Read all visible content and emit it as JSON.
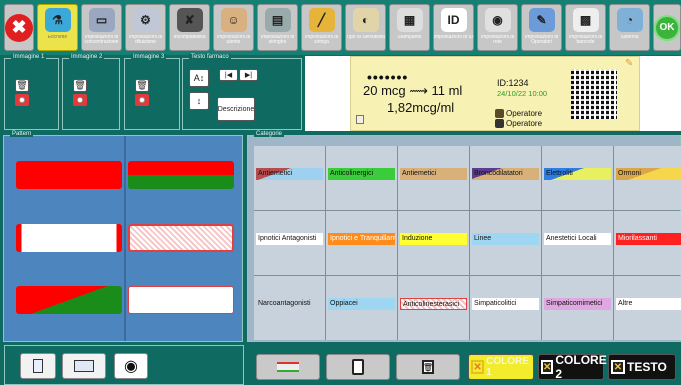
{
  "toolbar": {
    "close_label": "✖",
    "ok_label": "OK",
    "buttons": [
      {
        "id": "b1",
        "label": "Etichette",
        "glyph": "⚗",
        "color": "#3aa8d8",
        "active": true
      },
      {
        "id": "b2",
        "label": "Impostazioni di concentrazione",
        "glyph": "▭",
        "color": "#9aa7c0",
        "active": false
      },
      {
        "id": "b3",
        "label": "Impostazioni di diluizione",
        "glyph": "⚙",
        "color": "#c0c8d8",
        "active": false
      },
      {
        "id": "b4",
        "label": "Incompatibilità",
        "glyph": "✘",
        "color": "#555",
        "active": false
      },
      {
        "id": "b5",
        "label": "Impostazioni di utente",
        "glyph": "☺",
        "color": "#d9b07f",
        "active": false
      },
      {
        "id": "b6",
        "label": "Impostazioni di siringhe",
        "glyph": "▤",
        "color": "#9aa",
        "active": false
      },
      {
        "id": "b7",
        "label": "Impostazioni di siringa",
        "glyph": "╱",
        "color": "#e7b43a",
        "active": false
      },
      {
        "id": "b8",
        "label": "Tipo di Sensibilità",
        "glyph": "◐",
        "color": "#e0d4a8",
        "active": false
      },
      {
        "id": "b9",
        "label": "Stampante",
        "glyph": "▦",
        "color": "#ddd",
        "active": false
      },
      {
        "id": "b10",
        "label": "Impostazioni di ID",
        "glyph": "ID",
        "color": "#fff",
        "active": false
      },
      {
        "id": "b11",
        "label": "Impostazioni di rete",
        "glyph": "◉",
        "color": "#e0e0e0",
        "active": false
      },
      {
        "id": "b12",
        "label": "Impostazioni di Operatori",
        "glyph": "✎",
        "color": "#6b9bd8",
        "active": false
      },
      {
        "id": "b13",
        "label": "Impostazioni di barcode",
        "glyph": "▩",
        "color": "#eee",
        "active": false
      },
      {
        "id": "b14",
        "label": "Sistema",
        "glyph": "◔",
        "color": "#7fb0d8",
        "active": false
      }
    ]
  },
  "images": [
    {
      "title": "Immagine 1"
    },
    {
      "title": "Immagine 2"
    },
    {
      "title": "Immagine 3"
    }
  ],
  "text_group": {
    "title": "Testo farmaco",
    "font_size_icon": "A↕",
    "spacing_icon": "↕",
    "left_icon": "|◀",
    "right_icon": "▶|",
    "description_button": "Descrizione"
  },
  "label": {
    "dots": "•••••••",
    "dose_line1": "20 mcg ⟿ 11 ml",
    "dose_line2": "1,82mcg/ml",
    "id": "ID:1234",
    "date": "24/10/22 10:00",
    "operator1": "Operatore",
    "operator2": "Operatore"
  },
  "pattern_panel": {
    "title": "Pattern"
  },
  "category_panel": {
    "title": "Categorie",
    "rows": [
      [
        "Antiemetici",
        "Anticolinergici",
        "Antiemetici",
        "Broncodilatatori",
        "Elettroliti",
        "Ormoni"
      ],
      [
        "Ipnotici Antagonisti",
        "Ipnotici e Tranquillanti",
        "Induzione",
        "Linee",
        "Anestetici Locali",
        "Miorilassanti"
      ],
      [
        "Narcoantagonisti",
        "Oppiacei",
        "Anticolinesterasici",
        "Simpaticolitici",
        "Simpaticomimetici",
        "Altre"
      ]
    ]
  },
  "bottom": {
    "color1": "COLORE 1",
    "color2": "COLORE 2",
    "testo": "TESTO",
    "eye_icon": "◉"
  }
}
